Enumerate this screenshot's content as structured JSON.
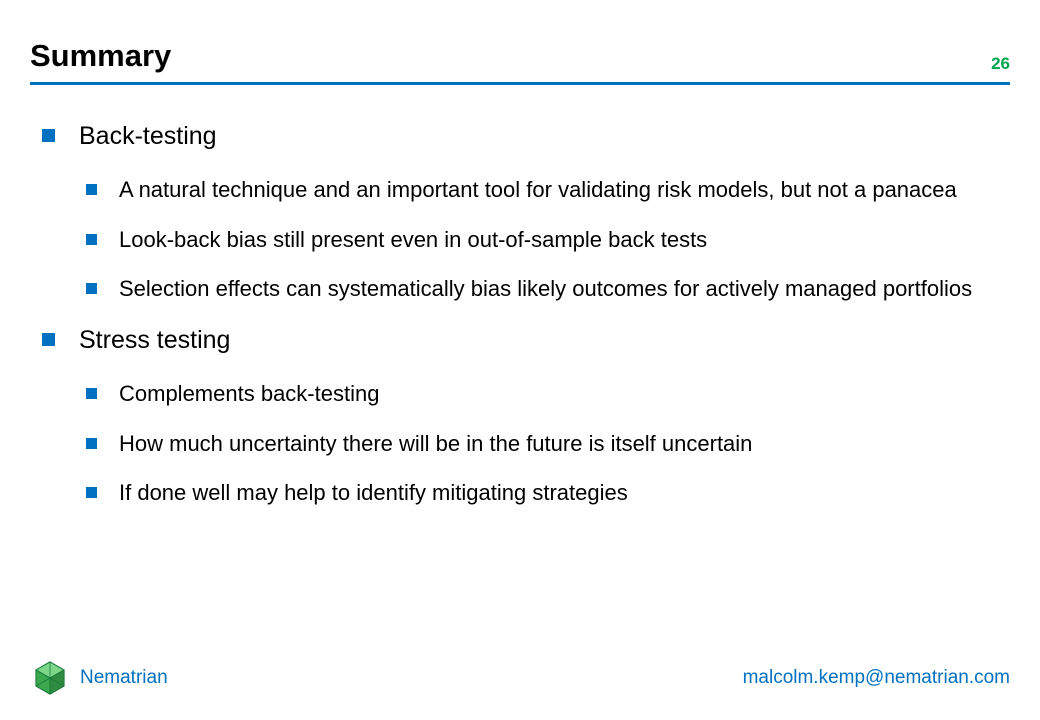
{
  "header": {
    "title": "Summary",
    "page_number": "26"
  },
  "colors": {
    "accent": "#0070c0",
    "page_num": "#00a651",
    "logo_dark": "#1a7a3a",
    "logo_light": "#5cc46a"
  },
  "content": {
    "sections": [
      {
        "heading": "Back-testing",
        "items": [
          "A natural technique and an important tool for validating risk models, but not a panacea",
          "Look-back bias still present even in out-of-sample back tests",
          "Selection effects can systematically bias likely outcomes for actively managed portfolios"
        ]
      },
      {
        "heading": "Stress testing",
        "items": [
          "Complements back-testing",
          "How much uncertainty there will be in the future is itself uncertain",
          "If done well may help to identify mitigating strategies"
        ]
      }
    ]
  },
  "footer": {
    "brand": "Nematrian",
    "contact": "malcolm.kemp@nematrian.com",
    "logo_name": "nematrian-logo"
  }
}
